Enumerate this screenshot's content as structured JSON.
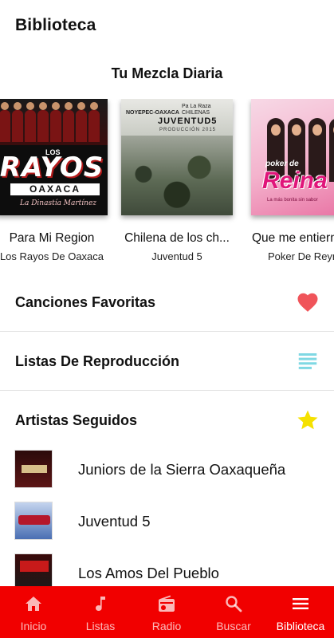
{
  "header": {
    "title": "Biblioteca"
  },
  "mix": {
    "title": "Tu Mezcla Diaria",
    "albums": [
      {
        "name": "Para Mi Region",
        "artist": "Los Rayos De Oaxaca",
        "cover_text": {
          "small": "LOS",
          "big": "RAYOS",
          "band": "OAXACA",
          "signature": "La Dinastía Martínez"
        }
      },
      {
        "name": "Chilena de los ch...",
        "artist": "Juventud 5",
        "cover_text": {
          "left": "NOYEPEC-OAXACA",
          "right": "Pa La Raza\nCHILENAS",
          "big": "JUVENTUD5",
          "sub": "PRODUCCIÓN 2015"
        }
      },
      {
        "name": "Que me entiern",
        "artist": "Poker De Reyn",
        "cover_text": {
          "small": "poker de",
          "big": "Reina",
          "sub": "La más bonita sin sabor"
        }
      }
    ]
  },
  "sections": {
    "favorites": {
      "label": "Canciones Favoritas",
      "icon": "heart-icon",
      "color": "#f0545a"
    },
    "playlists": {
      "label": "Listas De Reproducción",
      "icon": "list-icon",
      "color": "#7fd8e3"
    },
    "artists": {
      "label": "Artistas Seguidos",
      "icon": "star-icon",
      "color": "#f5e100"
    }
  },
  "followed_artists": [
    {
      "name": "Juniors de la Sierra Oaxaqueña"
    },
    {
      "name": "Juventud 5"
    },
    {
      "name": "Los Amos Del Pueblo"
    }
  ],
  "bottom_nav": {
    "background": "#f10000",
    "items": [
      {
        "label": "Inicio",
        "icon": "home-icon",
        "active": false
      },
      {
        "label": "Listas",
        "icon": "music-note-icon",
        "active": false
      },
      {
        "label": "Radio",
        "icon": "radio-icon",
        "active": false
      },
      {
        "label": "Buscar",
        "icon": "search-icon",
        "active": false
      },
      {
        "label": "Biblioteca",
        "icon": "menu-icon",
        "active": true
      }
    ]
  }
}
